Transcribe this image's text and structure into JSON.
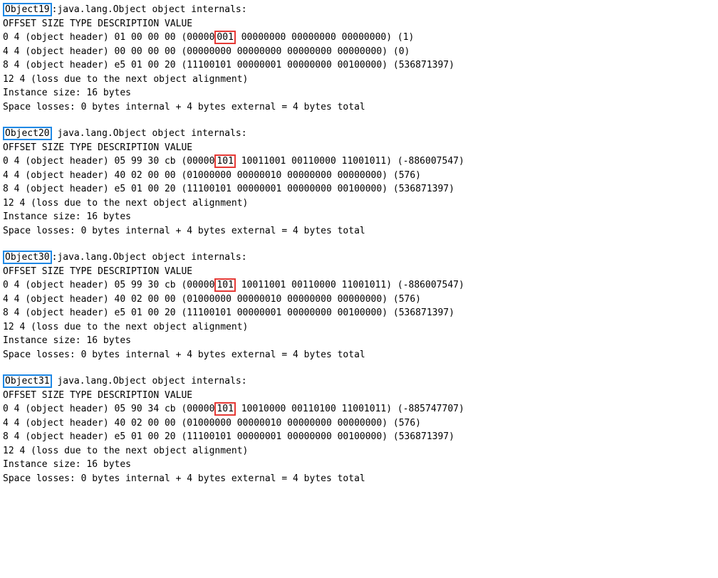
{
  "tableHeader": {
    "offset": "OFFSET",
    "size": "SIZE",
    "type": "TYPE",
    "description": "DESCRIPTION",
    "value": "VALUE"
  },
  "titleSuffix": "java.lang.Object object internals:",
  "instanceSize": "Instance size: 16 bytes",
  "spaceLosses": "Space losses: 0 bytes internal + 4 bytes external = 4 bytes total",
  "lossRow": {
    "offset": "12",
    "size": "4",
    "desc": "(loss due to the next object alignment)"
  },
  "objRows": {
    "a": {
      "offset": "0",
      "size": "4",
      "desc": "(object header)"
    },
    "b": {
      "offset": "4",
      "size": "4",
      "desc": "(object header)"
    },
    "c": {
      "offset": "8",
      "size": "4",
      "desc": "(object header)"
    }
  },
  "blocks": [
    {
      "name": "Object19",
      "sep": ":",
      "val0": {
        "pre": "01 00 00 00 (00000",
        "hl": "001",
        "post": " 00000000 00000000 00000000) (1)"
      },
      "val1": "00 00 00 00 (00000000 00000000 00000000 00000000) (0)",
      "val2": "e5 01 00 20 (11100101 00000001 00000000 00100000) (536871397)"
    },
    {
      "name": "Object20",
      "sep": " ",
      "val0": {
        "pre": "05 99 30 cb (00000",
        "hl": "101",
        "post": " 10011001 00110000 11001011) (-886007547)"
      },
      "val1": "40 02 00 00 (01000000 00000010 00000000 00000000) (576)",
      "val2": "e5 01 00 20 (11100101 00000001 00000000 00100000) (536871397)"
    },
    {
      "name": "Object30",
      "sep": ":",
      "val0": {
        "pre": "05 99 30 cb (00000",
        "hl": "101",
        "post": " 10011001 00110000 11001011) (-886007547)"
      },
      "val1": "40 02 00 00 (01000000 00000010 00000000 00000000) (576)",
      "val2": "e5 01 00 20 (11100101 00000001 00000000 00100000) (536871397)"
    },
    {
      "name": "Object31",
      "sep": " ",
      "val0": {
        "pre": "05 90 34 cb (00000",
        "hl": "101",
        "post": " 10010000 00110100 11001011) (-885747707)"
      },
      "val1": "40 02 00 00 (01000000 00000010 00000000 00000000) (576)",
      "val2": "e5 01 00 20 (11100101 00000001 00000000 00100000) (536871397)"
    }
  ]
}
